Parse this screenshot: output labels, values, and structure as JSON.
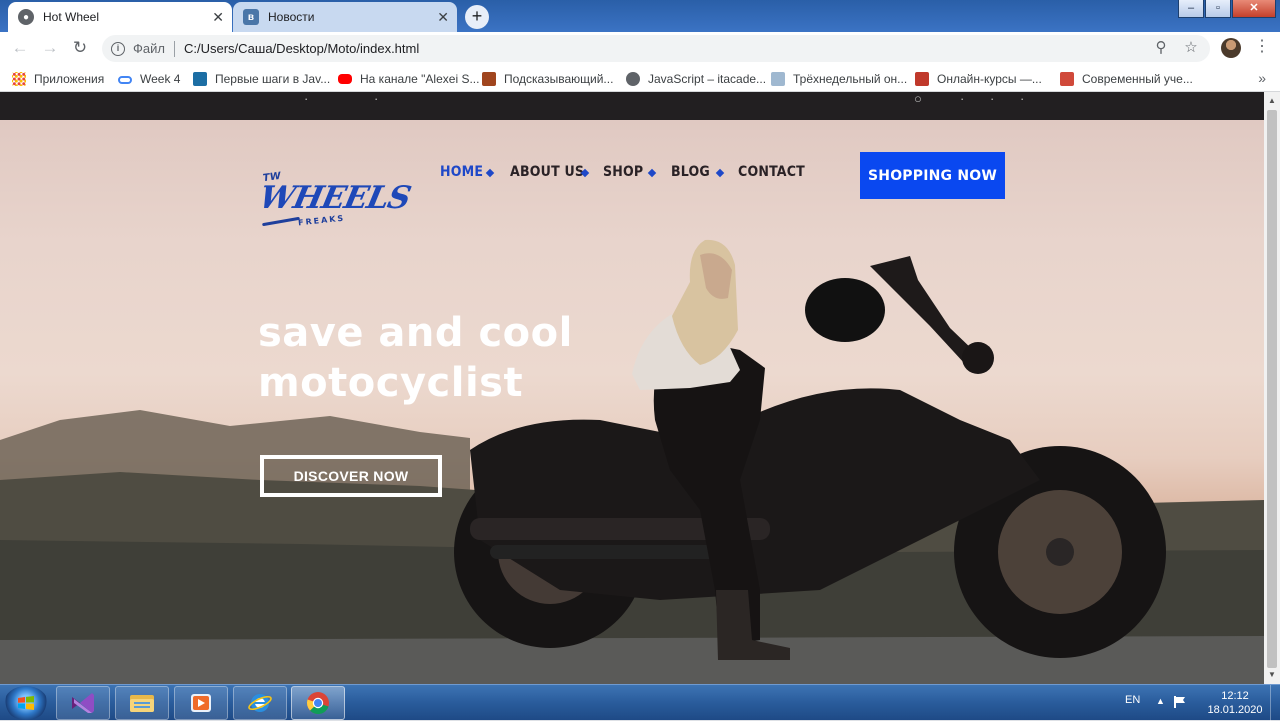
{
  "browser": {
    "tabs": [
      {
        "title": "Hot Wheel",
        "active": true
      },
      {
        "title": "Новости",
        "active": false
      }
    ],
    "new_tab_label": "+",
    "window_buttons": {
      "minimize": "–",
      "maximize": "▫",
      "close": "✕"
    },
    "toolbar": {
      "back": "←",
      "forward": "→",
      "reload": "↻",
      "scheme_label": "Файл",
      "url": "C:/Users/Саша/Desktop/Moto/index.html",
      "zoom_icon": "⚲",
      "star_icon": "☆",
      "menu_icon": "⋮"
    },
    "bookmarks": [
      {
        "label": "Приложения",
        "icon": "apps-grid-icon",
        "color": "#e8453c"
      },
      {
        "label": "Week 4",
        "icon": "link-icon",
        "color": "#4285f4"
      },
      {
        "label": "Первые шаги в Jav...",
        "icon": "bookmark-icon",
        "color": "#1c6ea4"
      },
      {
        "label": "На канале \"Alexei S...",
        "icon": "youtube-icon",
        "color": "#ff0000"
      },
      {
        "label": "Подсказывающий...",
        "icon": "bookmark-icon",
        "color": "#a0451e"
      },
      {
        "label": "JavaScript – itacade...",
        "icon": "globe-icon",
        "color": "#5f6368"
      },
      {
        "label": "Трёхнедельный он...",
        "icon": "bookmark-icon",
        "color": "#9fb8d0"
      },
      {
        "label": "Онлайн-курсы —...",
        "icon": "bookmark-icon",
        "color": "#c0392b"
      },
      {
        "label": "Современный уче...",
        "icon": "bookmark-icon",
        "color": "#d0493a"
      }
    ],
    "bookmarks_more": "»"
  },
  "site": {
    "logo": {
      "top": "TW",
      "main": "WHEELS",
      "sub": "FREAKS"
    },
    "nav": [
      {
        "label": "HOME",
        "active": true
      },
      {
        "label": "ABOUT US",
        "active": false
      },
      {
        "label": "SHOP",
        "active": false
      },
      {
        "label": "BLOG",
        "active": false
      },
      {
        "label": "CONTACT",
        "active": false
      }
    ],
    "cta_label": "SHOPPING NOW",
    "headline": "save and cool motocyclist",
    "discover_label": "DISCOVER NOW",
    "accent_color": "#0a48f0"
  },
  "taskbar": {
    "apps": [
      {
        "name": "visual-studio",
        "running": false
      },
      {
        "name": "explorer",
        "running": false
      },
      {
        "name": "media-player",
        "running": false
      },
      {
        "name": "internet-explorer",
        "running": false
      },
      {
        "name": "chrome",
        "running": true
      }
    ],
    "language": "EN",
    "time": "12:12",
    "date": "18.01.2020"
  }
}
